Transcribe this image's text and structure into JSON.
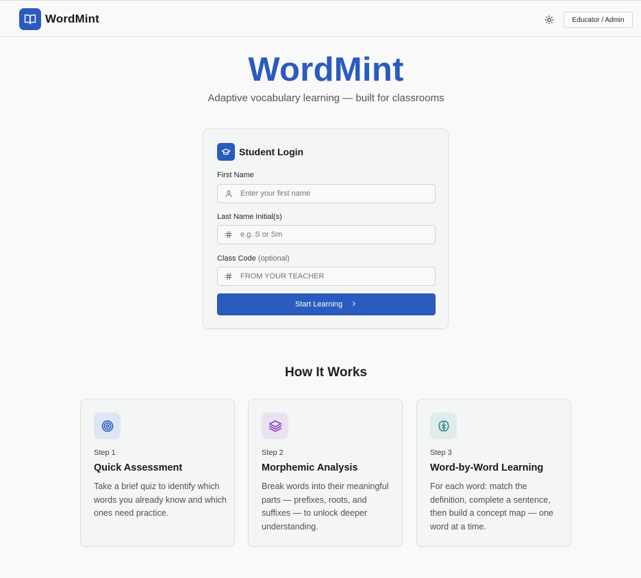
{
  "header": {
    "brand_name": "WordMint",
    "admin_button": "Educator / Admin"
  },
  "hero": {
    "title": "WordMint",
    "subtitle": "Adaptive vocabulary learning — built for classrooms"
  },
  "login": {
    "title": "Student Login",
    "first_name": {
      "label": "First Name",
      "placeholder": "Enter your first name",
      "value": ""
    },
    "last_initial": {
      "label": "Last Name Initial(s)",
      "placeholder": "e.g. S or Sm",
      "value": ""
    },
    "class_code": {
      "label": "Class Code",
      "optional": "(optional)",
      "placeholder": "FROM YOUR TEACHER",
      "value": ""
    },
    "submit": "Start Learning"
  },
  "how_it_works": {
    "title": "How It Works",
    "steps": [
      {
        "step": "Step 1",
        "title": "Quick Assessment",
        "description": "Take a brief quiz to identify which words you already know and which ones need practice.",
        "icon": "target-icon",
        "icon_color": "#2a5bbf",
        "icon_bg": "#dfe6f3"
      },
      {
        "step": "Step 2",
        "title": "Morphemic Analysis",
        "description": "Break words into their meaningful parts — prefixes, roots, and suffixes — to unlock deeper understanding.",
        "icon": "layers-icon",
        "icon_color": "#8a3fc2",
        "icon_bg": "#ebe2f1"
      },
      {
        "step": "Step 3",
        "title": "Word-by-Word Learning",
        "description": "For each word: match the definition, complete a sentence, then build a concept map — one word at a time.",
        "icon": "brain-icon",
        "icon_color": "#2a8a8a",
        "icon_bg": "#dfeceb"
      }
    ]
  },
  "colors": {
    "accent": "#2a5bbf",
    "background": "#f9f9f9",
    "card": "#f4f5f5"
  }
}
